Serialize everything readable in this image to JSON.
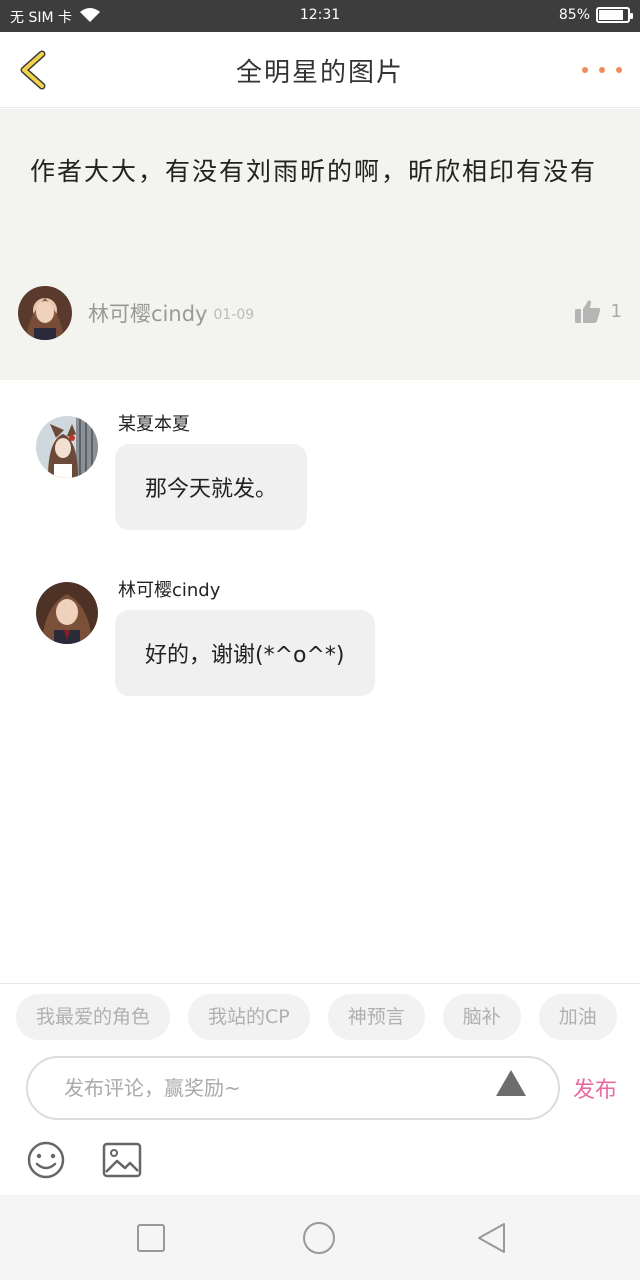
{
  "status_bar": {
    "carrier": "无 SIM 卡",
    "time": "12:31",
    "battery_text": "85%",
    "battery_level": 0.85
  },
  "nav": {
    "title": "全明星的图片"
  },
  "post": {
    "text": "作者大大，有没有刘雨昕的啊，昕欣相印有没有",
    "author": "林可樱cindy",
    "date": "01-09",
    "likes": "1"
  },
  "comments": [
    {
      "name": "某夏本夏",
      "text": "那今天就发。"
    },
    {
      "name": "林可樱cindy",
      "text": "好的，谢谢(*^o^*)"
    }
  ],
  "tags": [
    "我最爱的角色",
    "我站的CP",
    "神预言",
    "脑补",
    "加油"
  ],
  "composer": {
    "placeholder": "发布评论，赢奖励~",
    "publish_label": "发布"
  },
  "colors": {
    "accent": "#e86aa0",
    "back_arrow": "#f3d34a",
    "more_dots": "#f28b5b",
    "post_bg": "#f3f3ef"
  }
}
